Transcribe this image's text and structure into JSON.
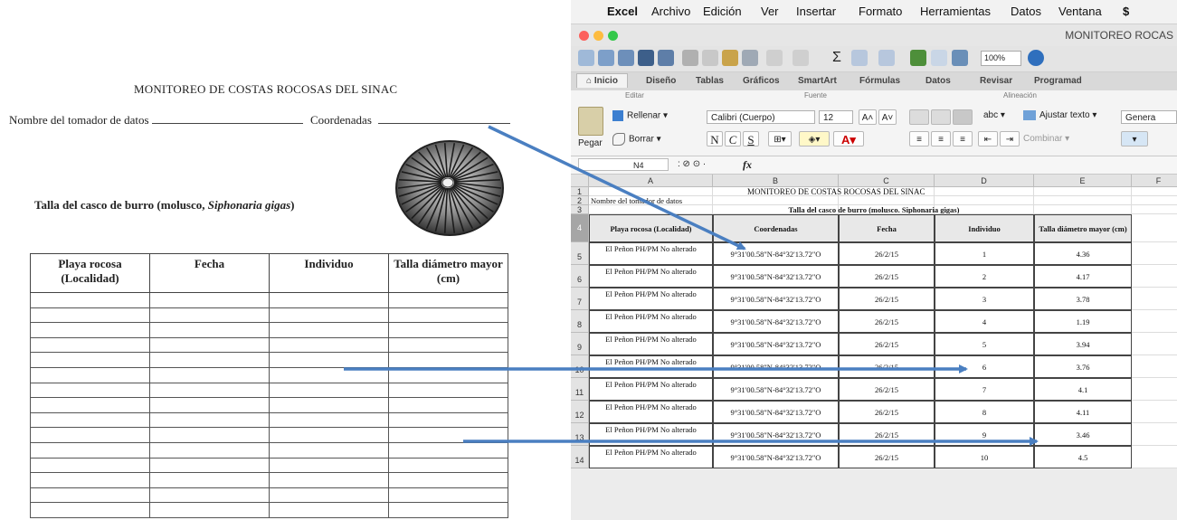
{
  "form": {
    "title": "MONITOREO DE COSTAS ROCOSAS DEL SINAC",
    "collector_label": "Nombre del tomador de datos",
    "coords_label": "Coordenadas",
    "subtitle_prefix": "Talla del casco de burro (molusco, ",
    "subtitle_species": "Siphonaria gigas",
    "subtitle_suffix": ")",
    "headers": [
      "Playa rocosa (Localidad)",
      "Fecha",
      "Individuo",
      "Talla diámetro mayor (cm)"
    ]
  },
  "excel": {
    "menu": [
      "Excel",
      "Archivo",
      "Edición",
      "Ver",
      "Insertar",
      "Formato",
      "Herramientas",
      "Datos",
      "Ventana"
    ],
    "window_title": "MONITOREO ROCAS",
    "zoom": "100%",
    "tabs": [
      "Inicio",
      "Diseño",
      "Tablas",
      "Gráficos",
      "SmartArt",
      "Fórmulas",
      "Datos",
      "Revisar",
      "Programad"
    ],
    "groups": {
      "edit": "Editar",
      "font": "Fuente",
      "align": "Alineación"
    },
    "ribbon": {
      "paste": "Pegar",
      "fill": "Rellenar",
      "clear": "Borrar",
      "font_name": "Calibri (Cuerpo)",
      "font_size": "12",
      "bold": "N",
      "italic": "C",
      "underline": "S",
      "abc": "abc",
      "wrap": "Ajustar texto",
      "merge": "Combinar",
      "number_format": "Genera"
    },
    "name_box": "N4",
    "fx": "fx",
    "columns": [
      "A",
      "B",
      "C",
      "D",
      "E",
      "F"
    ],
    "row_numbers": [
      "1",
      "2",
      "3",
      "4",
      "5",
      "6",
      "7",
      "8",
      "9",
      "10",
      "11",
      "12",
      "13",
      "14"
    ],
    "sheet_title": "MONITOREO DE COSTAS ROCOSAS DEL SINAC",
    "row2_label": "Nombre del tomador de datos",
    "table_title": "Talla del casco de burro (molusco. Siphonaria gigas)",
    "headers": [
      "Playa rocosa (Localidad)",
      "Coordenadas",
      "Fecha",
      "Individuo",
      "Talla diámetro mayor (cm)"
    ],
    "rows": [
      [
        "El Peñon PH/PM No alterado",
        "9°31'00.58\"N-84°32'13.72\"O",
        "26/2/15",
        "1",
        "4.36"
      ],
      [
        "El Peñon PH/PM No alterado",
        "9°31'00.58\"N-84°32'13.72\"O",
        "26/2/15",
        "2",
        "4.17"
      ],
      [
        "El Peñon PH/PM No alterado",
        "9°31'00.58\"N-84°32'13.72\"O",
        "26/2/15",
        "3",
        "3.78"
      ],
      [
        "El Peñon PH/PM No alterado",
        "9°31'00.58\"N-84°32'13.72\"O",
        "26/2/15",
        "4",
        "1.19"
      ],
      [
        "El Peñon PH/PM No alterado",
        "9°31'00.58\"N-84°32'13.72\"O",
        "26/2/15",
        "5",
        "3.94"
      ],
      [
        "El Peñon PH/PM No alterado",
        "9°31'00.58\"N-84°32'13.72\"O",
        "26/2/15",
        "6",
        "3.76"
      ],
      [
        "El Peñon PH/PM No alterado",
        "9°31'00.58\"N-84°32'13.72\"O",
        "26/2/15",
        "7",
        "4.1"
      ],
      [
        "El Peñon PH/PM No alterado",
        "9°31'00.58\"N-84°32'13.72\"O",
        "26/2/15",
        "8",
        "4.11"
      ],
      [
        "El Peñon PH/PM No alterado",
        "9°31'00.58\"N-84°32'13.72\"O",
        "26/2/15",
        "9",
        "3.46"
      ],
      [
        "El Peñon PH/PM No alterado",
        "9°31'00.58\"N-84°32'13.72\"O",
        "26/2/15",
        "10",
        "4.5"
      ]
    ]
  },
  "colors": {
    "arrow": "#4a7fc1",
    "excel_green": "#2e7d32",
    "table_header_bg": "#e8e8e8"
  }
}
